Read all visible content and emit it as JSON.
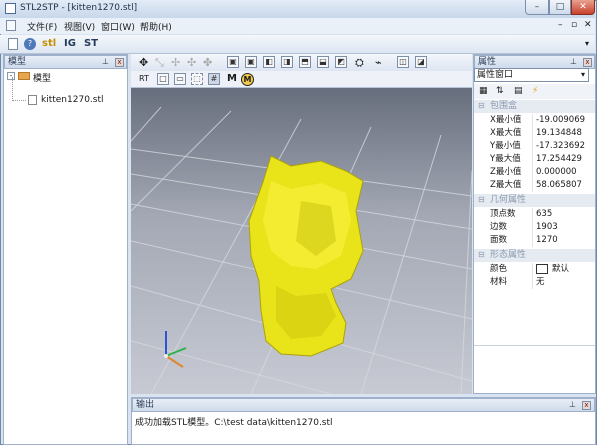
{
  "window": {
    "title": "STL2STP - [kitten1270.stl]",
    "min": "–",
    "max": "□",
    "close": "✕"
  },
  "menu": [
    "文件(F)",
    "视图(V)",
    "窗口(W)",
    "帮助(H)"
  ],
  "toolbar": {
    "stl": "stl",
    "ig": "IG",
    "st": "ST"
  },
  "left_panel": {
    "title": "模型",
    "tree_root": "模型",
    "tree_child": "kitten1270.stl"
  },
  "view_toolbar2": {
    "rt": "RT",
    "m1": "M",
    "m2": "M"
  },
  "right_panel": {
    "title": "属性",
    "select": "属性窗口",
    "sections": {
      "bbox": "包围盒",
      "geom": "几何属性",
      "shape": "形态属性"
    },
    "bbox": [
      {
        "k": "X最小值",
        "v": "-19.009069"
      },
      {
        "k": "X最大值",
        "v": "19.134848"
      },
      {
        "k": "Y最小值",
        "v": "-17.323692"
      },
      {
        "k": "Y最大值",
        "v": "17.254429"
      },
      {
        "k": "Z最小值",
        "v": "0.000000"
      },
      {
        "k": "Z最大值",
        "v": "58.065807"
      }
    ],
    "geom": [
      {
        "k": "顶点数",
        "v": "635"
      },
      {
        "k": "边数",
        "v": "1903"
      },
      {
        "k": "面数",
        "v": "1270"
      }
    ],
    "shape": [
      {
        "k": "颜色",
        "v": "默认"
      },
      {
        "k": "材料",
        "v": "无"
      }
    ]
  },
  "output": {
    "title": "输出",
    "message": "成功加载STL模型。C:\\test data\\kitten1270.stl"
  }
}
